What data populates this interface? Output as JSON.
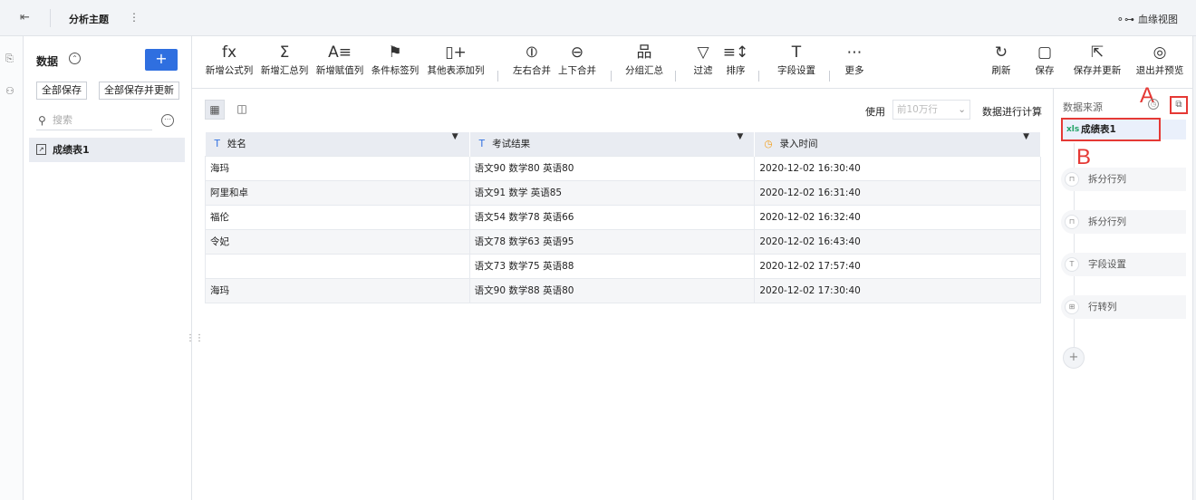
{
  "topbar": {
    "title": "分析主题",
    "more_icon": "⋮",
    "lineage_label": "血缘视图"
  },
  "data_panel": {
    "title": "数据",
    "add_label": "+",
    "save_all": "全部保存",
    "save_all_update": "全部保存并更新",
    "search_placeholder": "搜索",
    "table_name": "成绩表1"
  },
  "toolbar": {
    "items": [
      {
        "icon": "fx",
        "label": "新增公式列"
      },
      {
        "icon": "Σ",
        "label": "新增汇总列"
      },
      {
        "icon": "A≡",
        "label": "新增赋值列"
      },
      {
        "icon": "⚑",
        "label": "条件标签列"
      },
      {
        "icon": "▯+",
        "label": "其他表添加列"
      },
      {
        "icon": "⦶",
        "label": "左右合并"
      },
      {
        "icon": "⊖",
        "label": "上下合并"
      },
      {
        "icon": "品",
        "label": "分组汇总"
      },
      {
        "icon": "▽",
        "label": "过滤"
      },
      {
        "icon": "≡↕",
        "label": "排序"
      },
      {
        "icon": "T",
        "label": "字段设置"
      },
      {
        "icon": "⋯",
        "label": "更多"
      },
      {
        "icon": "↻",
        "label": "刷新"
      },
      {
        "icon": "▢",
        "label": "保存"
      },
      {
        "icon": "⇱",
        "label": "保存并更新"
      },
      {
        "icon": "◎",
        "label": "退出并预览"
      }
    ]
  },
  "subbar": {
    "use_label": "使用",
    "row_limit": "前10万行",
    "calc_label": "数据进行计算"
  },
  "grid": {
    "columns": [
      {
        "type_icon": "T",
        "name": "姓名"
      },
      {
        "type_icon": "T",
        "name": "考试结果"
      },
      {
        "type_icon": "◷",
        "name": "录入时间"
      }
    ],
    "rows": [
      [
        "海玛",
        "语文90 数学80 英语80",
        "2020-12-02 16:30:40"
      ],
      [
        "阿里和卓",
        "语文91 数学 英语85",
        "2020-12-02 16:31:40"
      ],
      [
        "福伦",
        "语文54 数学78 英语66",
        "2020-12-02 16:32:40"
      ],
      [
        "令妃",
        "语文78 数学63 英语95",
        "2020-12-02 16:43:40"
      ],
      [
        "",
        "语文73 数学75 英语88",
        "2020-12-02 17:57:40"
      ],
      [
        "海玛",
        "语文90 数学88 英语80",
        "2020-12-02 17:30:40"
      ]
    ]
  },
  "sidebar": {
    "title": "数据来源",
    "source": "成绩表1",
    "source_badge": "xls",
    "annotation_a": "A",
    "annotation_b": "B",
    "steps": [
      "拆分行列",
      "拆分行列",
      "字段设置",
      "行转列"
    ],
    "add_label": "+"
  },
  "colors": {
    "accent": "#2f6fe0",
    "highlight": "#e53935",
    "header_bg": "#e9ecf2"
  }
}
